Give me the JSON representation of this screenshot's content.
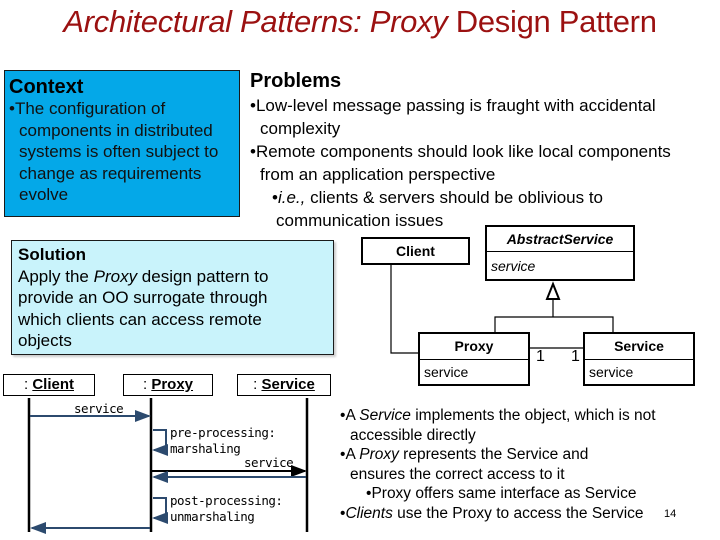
{
  "title": {
    "italic_part": "Architectural Patterns: Proxy",
    "normal_part": " Design Pattern"
  },
  "context": {
    "heading": "Context",
    "bullet": "•",
    "lines": [
      "The configuration of",
      "components in distributed",
      "systems is often subject to",
      "change as requirements",
      "evolve"
    ]
  },
  "problems": {
    "heading": "Problems",
    "bullets": [
      {
        "marker": "•",
        "lines": [
          "Low-level message passing is fraught with accidental",
          "complexity"
        ]
      },
      {
        "marker": "•",
        "lines": [
          "Remote components should look like local components",
          "from an application perspective"
        ]
      }
    ],
    "sub_bullet": {
      "marker": "•",
      "italic": "i.e.,",
      "rest": " clients & servers should be oblivious to",
      "line2": "communication issues"
    }
  },
  "solution": {
    "heading": "Solution",
    "line1_pre": "Apply the ",
    "line1_italic": "Proxy",
    "line1_post": " design pattern to",
    "lines": [
      "provide an OO surrogate through",
      "which clients can access remote",
      "objects"
    ]
  },
  "sequence_diagram": {
    "lifelines": [
      {
        "prefix": ": ",
        "name": "Client"
      },
      {
        "prefix": ": ",
        "name": "Proxy"
      },
      {
        "prefix": ": ",
        "name": "Service"
      }
    ],
    "messages": {
      "client_to_proxy": "service",
      "pre_processing": [
        "pre-processing:",
        "marshaling"
      ],
      "proxy_to_service": "service",
      "post_processing": [
        "post-processing:",
        "unmarshaling"
      ]
    }
  },
  "class_diagram": {
    "abstract_service": {
      "name": "AbstractService",
      "operation": "service"
    },
    "client": {
      "name": "Client"
    },
    "proxy": {
      "name": "Proxy",
      "operation": "service"
    },
    "service": {
      "name": "Service",
      "operation": "service"
    },
    "multiplicity_left": "1",
    "multiplicity_right": "1"
  },
  "notes": {
    "b1": {
      "marker": "•",
      "pre": "A ",
      "italic": "Service",
      "post": " implements the object, which is not",
      "line2": "accessible directly"
    },
    "b2": {
      "marker": "•",
      "pre": "A ",
      "italic": "Proxy",
      "post": " represents the Service and",
      "line2": "ensures the correct access to it"
    },
    "b3": {
      "marker": "•",
      "text": "Proxy offers same interface as Service"
    },
    "b4": {
      "marker": "•",
      "italic": "Clients",
      "post": " use the Proxy to access the Service"
    }
  },
  "page_number": "14",
  "colors": {
    "title": "#9b1111",
    "context_bg": "#04a8e8",
    "solution_bg": "#c9f3fb",
    "arrow_blue": "#2c4a6e"
  }
}
